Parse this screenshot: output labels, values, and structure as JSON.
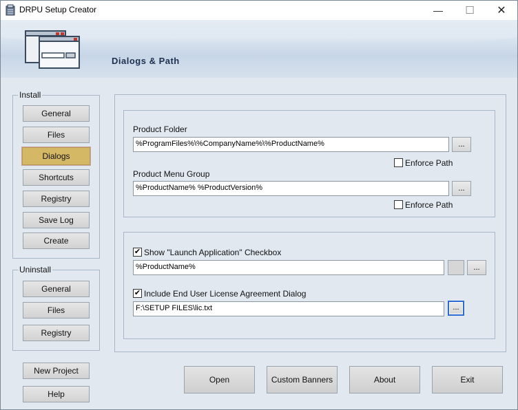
{
  "window": {
    "title": "DRPU Setup Creator",
    "controls": {
      "minimize": "—",
      "maximize": "☐",
      "close": "✕"
    }
  },
  "header": {
    "title": "Dialogs & Path"
  },
  "install": {
    "label": "Install",
    "items": [
      {
        "label": "General"
      },
      {
        "label": "Files"
      },
      {
        "label": "Dialogs",
        "active": true
      },
      {
        "label": "Shortcuts"
      },
      {
        "label": "Registry"
      },
      {
        "label": "Save Log"
      },
      {
        "label": "Create"
      }
    ]
  },
  "uninstall": {
    "label": "Uninstall",
    "items": [
      {
        "label": "General"
      },
      {
        "label": "Files"
      },
      {
        "label": "Registry"
      }
    ]
  },
  "project": {
    "new_project": "New Project",
    "help": "Help"
  },
  "paths": {
    "product_folder_label": "Product Folder",
    "product_folder_value": "%ProgramFiles%\\%CompanyName%\\%ProductName%",
    "product_folder_browse": "...",
    "enforce_path_1": "Enforce Path",
    "enforce_path_1_checked": false,
    "menu_group_label": "Product Menu Group",
    "menu_group_value": "%ProductName% %ProductVersion%",
    "menu_group_browse": "...",
    "enforce_path_2": "Enforce Path",
    "enforce_path_2_checked": false
  },
  "options": {
    "launch_label": "Show \"Launch Application\" Checkbox",
    "launch_checked": true,
    "launch_value": "%ProductName%",
    "launch_browse": "...",
    "eula_label": "Include End User License Agreement Dialog",
    "eula_checked": true,
    "eula_value": "F:\\SETUP FILES\\lic.txt",
    "eula_browse": "..."
  },
  "footer": {
    "open": "Open",
    "custom_banners": "Custom Banners",
    "about": "About",
    "exit": "Exit"
  },
  "colors": {
    "background": "#e1e8f0",
    "active_tab": "#d4b866",
    "focus_border": "#2d6bd1"
  }
}
